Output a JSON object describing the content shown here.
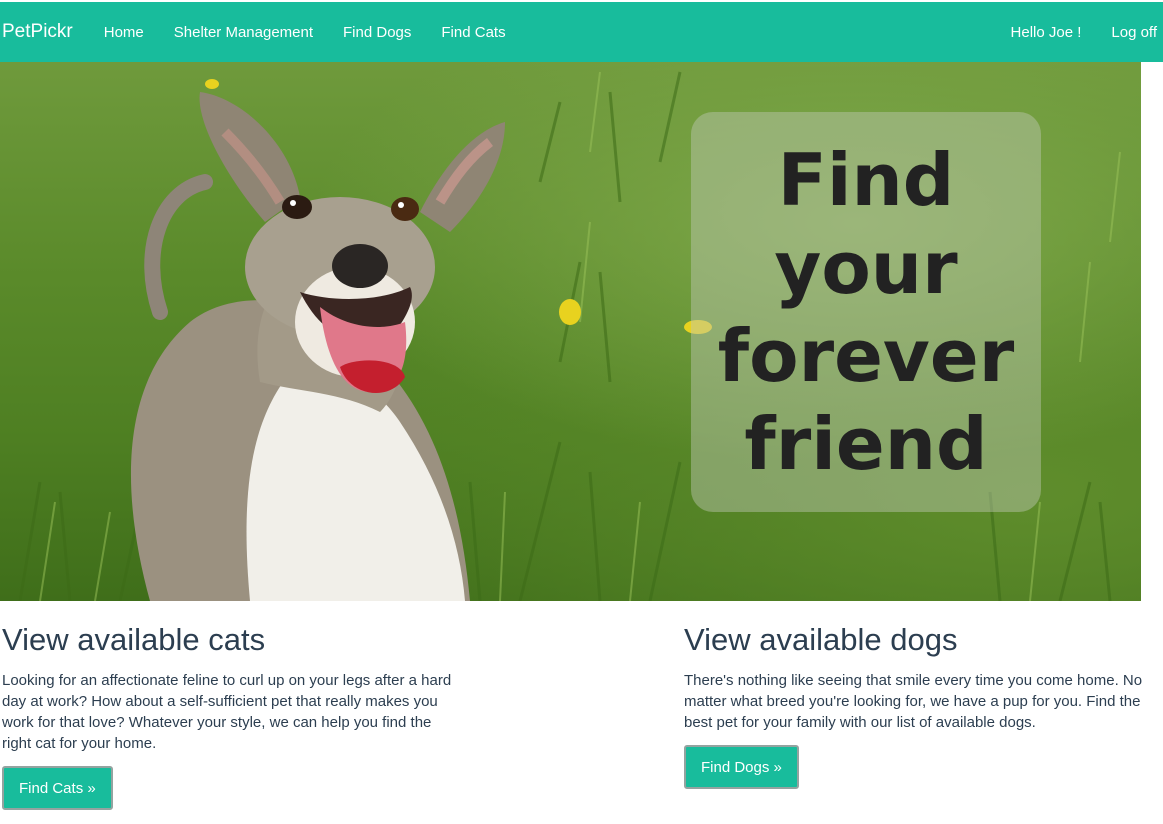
{
  "nav": {
    "brand": "PetPickr",
    "links": [
      "Home",
      "Shelter Management",
      "Find Dogs",
      "Find Cats"
    ],
    "greeting": "Hello Joe !",
    "logoff": "Log off"
  },
  "hero": {
    "tagline": "Find your forever friend"
  },
  "cats": {
    "heading": "View available cats",
    "body": "Looking for an affectionate feline to curl up on your legs after a hard day at work? How about a self-sufficient pet that really makes you work for that love? Whatever your style, we can help you find the right cat for your home.",
    "button": "Find Cats »"
  },
  "dogs": {
    "heading": "View available dogs",
    "body": "There's nothing like seeing that smile every time you come home. No matter what breed you're looking for, we have a pup for you. Find the best pet for your family with our list of available dogs.",
    "button": "Find Dogs »"
  },
  "colors": {
    "accent": "#18bc9c",
    "text": "#2c3e50"
  }
}
